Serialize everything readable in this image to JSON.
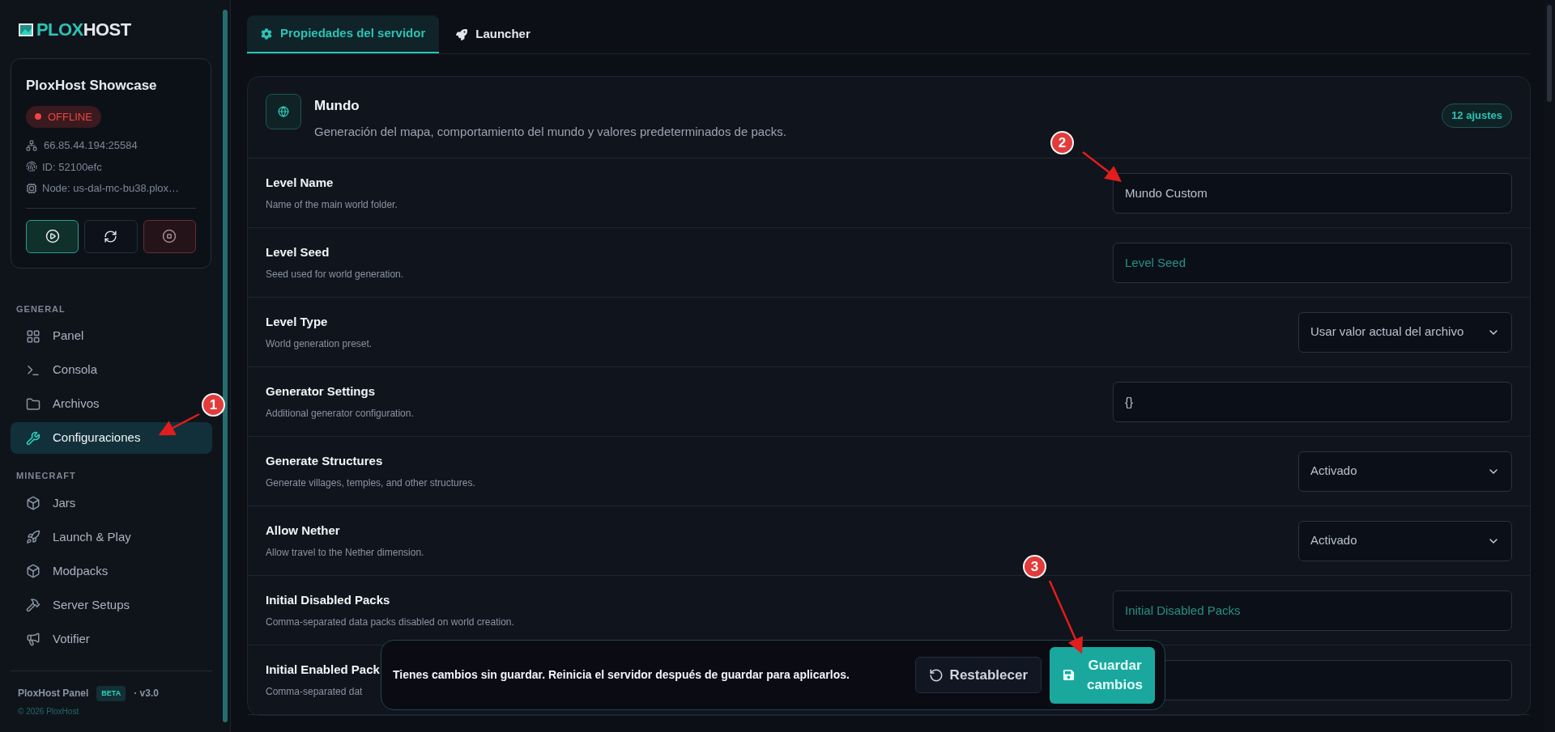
{
  "logo": {
    "part_1": "PLOX",
    "part_2": "HOST"
  },
  "server": {
    "name": "PloxHost Showcase",
    "status": "OFFLINE",
    "online": false,
    "address": "66.85.44.194:25584",
    "id": "ID: 52100efc",
    "node": "Node: us-dal-mc-bu38.plox…"
  },
  "sidebar": {
    "sections": [
      {
        "title": "GENERAL",
        "items": [
          {
            "label": "Panel",
            "selected": false
          },
          {
            "label": "Consola",
            "selected": false
          },
          {
            "label": "Archivos",
            "selected": false
          },
          {
            "label": "Configuraciones",
            "selected": true
          }
        ]
      },
      {
        "title": "MINECRAFT",
        "items": [
          {
            "label": "Jars",
            "selected": false
          },
          {
            "label": "Launch & Play",
            "selected": false
          },
          {
            "label": "Modpacks",
            "selected": false
          },
          {
            "label": "Server Setups",
            "selected": false
          },
          {
            "label": "Votifier",
            "selected": false
          }
        ]
      }
    ]
  },
  "footer": {
    "name": "PloxHost Panel",
    "badge": "BETA",
    "version": "· v3.0",
    "copyright": "© 2026 PloxHost"
  },
  "tabs": [
    {
      "label": "Propiedades del servidor",
      "selected": true
    },
    {
      "label": "Launcher",
      "selected": false
    }
  ],
  "section": {
    "title": "Mundo",
    "description": "Generación del mapa, comportamiento del mundo y valores predeterminados de packs.",
    "count": "12 ajustes"
  },
  "rows": [
    {
      "title": "Level Name",
      "description": "Name of the main world folder.",
      "kind": "text",
      "value": "Mundo Custom"
    },
    {
      "title": "Level Seed",
      "description": "Seed used for world generation.",
      "kind": "text",
      "placeholder": "Level Seed"
    },
    {
      "title": "Level Type",
      "description": "World generation preset.",
      "kind": "select",
      "value": "Usar valor actual del archivo"
    },
    {
      "title": "Generator Settings",
      "description": "Additional generator configuration.",
      "kind": "text",
      "value": "{}"
    },
    {
      "title": "Generate Structures",
      "description": "Generate villages, temples, and other structures.",
      "kind": "select",
      "value": "Activado"
    },
    {
      "title": "Allow Nether",
      "description": "Allow travel to the Nether dimension.",
      "kind": "select",
      "value": "Activado"
    },
    {
      "title": "Initial Disabled Packs",
      "description": "Comma-separated data packs disabled on world creation.",
      "kind": "text",
      "placeholder": "Initial Disabled Packs"
    },
    {
      "title": "Initial Enabled Pack",
      "description": "Comma-separated dat",
      "kind": "text"
    }
  ],
  "toast": {
    "message": "Tienes cambios sin guardar. Reinicia el servidor después de guardar para aplicarlos.",
    "reset": "Restablecer",
    "save": "Guardar cambios"
  },
  "annotations": [
    {
      "number": "1"
    },
    {
      "number": "2"
    },
    {
      "number": "3"
    }
  ]
}
